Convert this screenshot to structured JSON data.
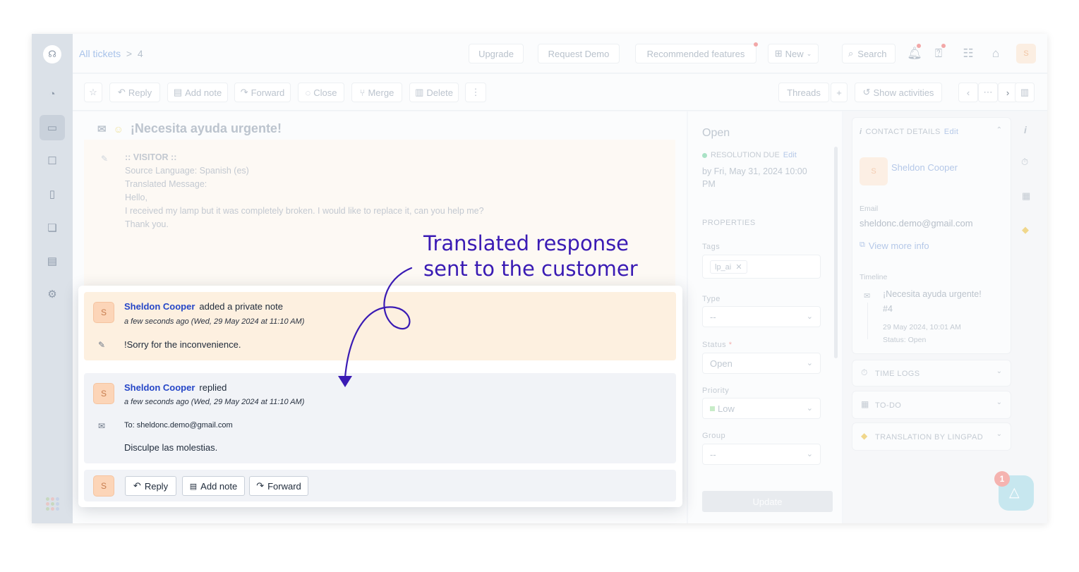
{
  "topbar": {
    "breadcrumb_link": "All tickets",
    "breadcrumb_sep": ">",
    "breadcrumb_current": "4",
    "upgrade": "Upgrade",
    "request_demo": "Request Demo",
    "recommended": "Recommended features",
    "new": "New",
    "search_placeholder": "Search",
    "avatar": "S"
  },
  "toolbar": {
    "reply": "Reply",
    "add_note": "Add note",
    "forward": "Forward",
    "close": "Close",
    "merge": "Merge",
    "delete": "Delete",
    "threads": "Threads",
    "show_activities": "Show activities"
  },
  "ticket": {
    "subject": "¡Necesita ayuda urgente!",
    "visitor_header": ":: VISITOR ::",
    "visitor_lines": [
      "Source Language: Spanish (es)",
      "Translated Message:",
      "Hello,",
      "I received my lamp but it was completely broken. I would like to replace it, can you help me?",
      "Thank you."
    ]
  },
  "properties": {
    "status_title": "Open",
    "resolution_due": "RESOLUTION DUE",
    "edit": "Edit",
    "due_line1": "by Fri, May 31, 2024 10:00",
    "due_line2": "PM",
    "properties_label": "PROPERTIES",
    "tags_label": "Tags",
    "tag": "lp_ai",
    "type_label": "Type",
    "type_value": "--",
    "status_label": "Status",
    "status_value": "Open",
    "priority_label": "Priority",
    "priority_value": "Low",
    "group_label": "Group",
    "group_value": "--",
    "update": "Update"
  },
  "contact": {
    "header": "CONTACT DETAILS",
    "edit": "Edit",
    "avatar": "S",
    "name": "Sheldon Cooper",
    "email_label": "Email",
    "email": "sheldonc.demo@gmail.com",
    "view_more": "View more info",
    "timeline_label": "Timeline",
    "timeline_title": "¡Necesita ayuda urgente!",
    "timeline_id": "#4",
    "timeline_date": "29 May 2024, 10:01 AM",
    "timeline_status": "Status: Open",
    "time_logs": "TIME LOGS",
    "todo": "TO-DO",
    "translation": "TRANSLATION BY LINGPAD",
    "badge_count": "1"
  },
  "callout": {
    "line1": "Translated response",
    "line2": "sent to the customer"
  },
  "popup": {
    "note": {
      "avatar": "S",
      "author": "Sheldon Cooper",
      "action": "added a private note",
      "time": "a few seconds ago (Wed, 29 May 2024 at 11:10 AM)",
      "body": "!Sorry for the inconvenience."
    },
    "reply": {
      "avatar": "S",
      "author": "Sheldon Cooper",
      "action": "replied",
      "time": "a few seconds ago (Wed, 29 May 2024 at 11:10 AM)",
      "to_label": "To:",
      "to_email": "sheldonc.demo@gmail.com",
      "body": "Disculpe las molestias."
    },
    "actions": {
      "avatar": "S",
      "reply": "Reply",
      "add_note": "Add note",
      "forward": "Forward"
    }
  },
  "colors": {
    "callout": "#3a1bb4",
    "author_link": "#2546c7",
    "note_bg": "#fdf0e0",
    "reply_bg": "#f1f3f7"
  }
}
